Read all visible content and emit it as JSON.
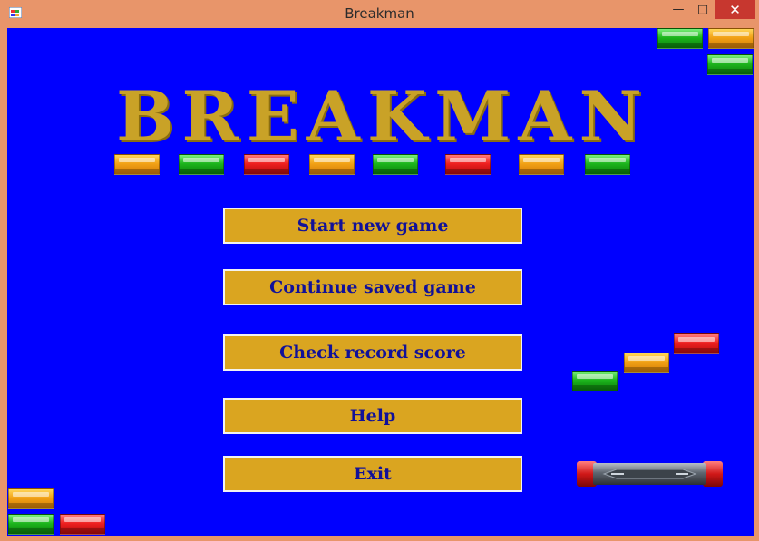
{
  "window": {
    "title": "Breakman",
    "minimize_glyph": "—",
    "maximize_glyph": "□",
    "close_glyph": "✕"
  },
  "logo": {
    "letters": [
      "B",
      "R",
      "E",
      "A",
      "K",
      "M",
      "A",
      "N"
    ],
    "color": "#c9a227"
  },
  "menu": {
    "start_label": "Start new game",
    "continue_label": "Continue saved game",
    "record_label": "Check record score",
    "help_label": "Help",
    "exit_label": "Exit"
  },
  "colors": {
    "background": "#0000ff",
    "button_fill": "#daa520",
    "button_text": "#111199",
    "window_frame": "#e8956a",
    "close_button": "#c7372f"
  },
  "bricks": {
    "colors": [
      "orange",
      "green",
      "red"
    ]
  }
}
